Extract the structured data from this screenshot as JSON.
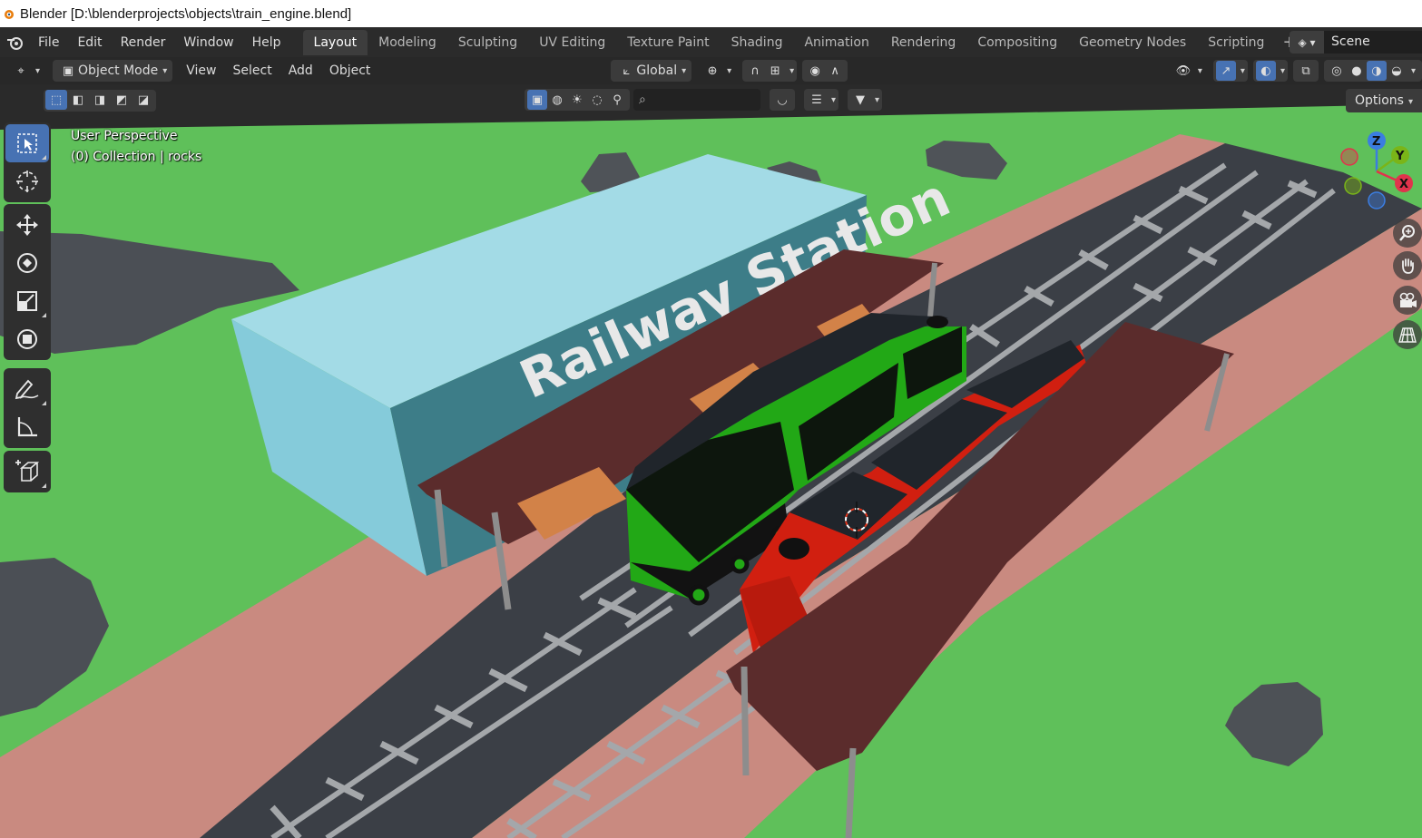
{
  "window": {
    "title": "Blender [D:\\blenderprojects\\objects\\train_engine.blend]",
    "app_icon": "blender-icon"
  },
  "topbar": {
    "menus": [
      "File",
      "Edit",
      "Render",
      "Window",
      "Help"
    ],
    "workspaces": [
      "Layout",
      "Modeling",
      "Sculpting",
      "UV Editing",
      "Texture Paint",
      "Shading",
      "Animation",
      "Rendering",
      "Compositing",
      "Geometry Nodes",
      "Scripting"
    ],
    "active_workspace": "Layout",
    "add_workspace": "+",
    "scene_name": "Scene"
  },
  "viewport_header": {
    "mode": "Object Mode",
    "menus": [
      "View",
      "Select",
      "Add",
      "Object"
    ],
    "transform_orientation": "Global",
    "options_label": "Options"
  },
  "viewport": {
    "perspective_label": "User Perspective",
    "collection_label": "(0) Collection | rocks",
    "station_sign": "Railway Station",
    "gizmo_axes": [
      "Z",
      "Y",
      "X"
    ]
  },
  "colors": {
    "grass": "#5fc05a",
    "platform": "#c98a80",
    "track_bed": "#3b3f46",
    "rails": "#a4a7aa",
    "station": "#85cbda",
    "roof": "#5b2c2c",
    "engine_green": "#22a816",
    "engine_red": "#d11f10",
    "accent_blue": "#4772b3"
  }
}
